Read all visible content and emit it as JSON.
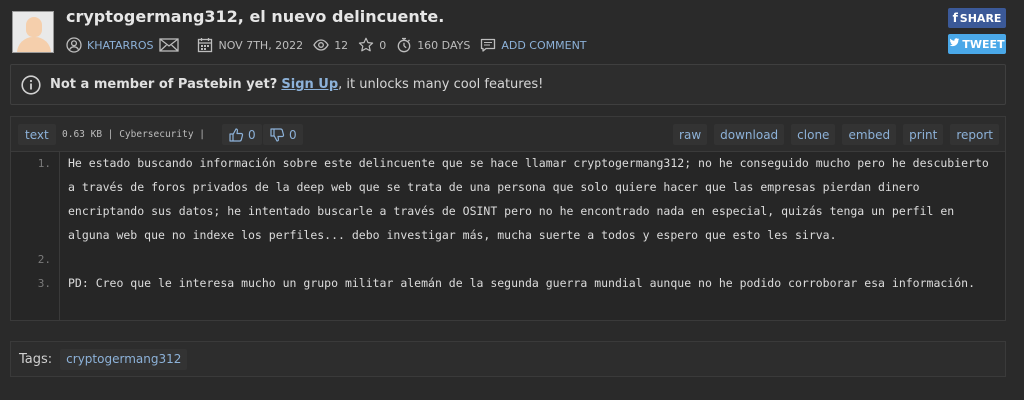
{
  "paste": {
    "title": "cryptogermang312, el nuevo delincuente.",
    "author": "KHATARROS",
    "date": "NOV 7TH, 2022",
    "views": "12",
    "stars": "0",
    "expiry": "160 DAYS",
    "add_comment": "ADD COMMENT"
  },
  "share": {
    "facebook": "SHARE",
    "twitter": "TWEET"
  },
  "notice": {
    "prefix": "Not a member of Pastebin yet?",
    "link": "Sign Up",
    "suffix": ", it unlocks many cool features!"
  },
  "code_header": {
    "syntax": "text",
    "info": "0.63 KB | Cybersecurity |",
    "likes": "0",
    "dislikes": "0",
    "actions": [
      "raw",
      "download",
      "clone",
      "embed",
      "print",
      "report"
    ]
  },
  "code_lines": [
    {
      "number": "1.",
      "text": "He estado buscando información sobre este delincuente que se hace llamar cryptogermang312; no he conseguido mucho pero he descubierto a través de foros privados de la deep web que se trata de una persona que solo quiere hacer que las empresas pierdan dinero encriptando sus datos; he intentado buscarle a través de OSINT pero no he encontrado nada en especial, quizás tenga un perfil en alguna web que no indexe los perfiles... debo investigar más, mucha suerte a todos y espero que esto les sirva."
    },
    {
      "number": "2.",
      "text": ""
    },
    {
      "number": "3.",
      "text": "PD: Creo que le interesa mucho un grupo militar alemán de la segunda guerra mundial aunque no he podido corroborar esa información."
    }
  ],
  "tags": {
    "label": "Tags:",
    "items": [
      "cryptogermang312"
    ]
  },
  "colors": {
    "background": "#2a2a2a",
    "link": "#8db2d9",
    "facebook": "#3b5998",
    "twitter": "#4aa8e8"
  }
}
